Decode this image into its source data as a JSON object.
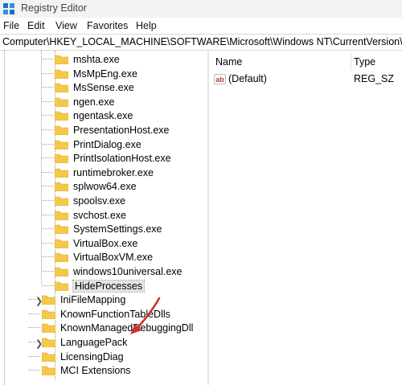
{
  "window": {
    "title": "Registry Editor"
  },
  "menu": [
    "File",
    "Edit",
    "View",
    "Favorites",
    "Help"
  ],
  "address": "Computer\\HKEY_LOCAL_MACHINE\\SOFTWARE\\Microsoft\\Windows NT\\CurrentVersion\\Image",
  "tree": {
    "items": [
      {
        "label": "mshta.exe"
      },
      {
        "label": "MsMpEng.exe"
      },
      {
        "label": "MsSense.exe"
      },
      {
        "label": "ngen.exe"
      },
      {
        "label": "ngentask.exe"
      },
      {
        "label": "PresentationHost.exe"
      },
      {
        "label": "PrintDialog.exe"
      },
      {
        "label": "PrintIsolationHost.exe"
      },
      {
        "label": "runtimebroker.exe"
      },
      {
        "label": "splwow64.exe"
      },
      {
        "label": "spoolsv.exe"
      },
      {
        "label": "svchost.exe"
      },
      {
        "label": "SystemSettings.exe"
      },
      {
        "label": "VirtualBox.exe"
      },
      {
        "label": "VirtualBoxVM.exe"
      },
      {
        "label": "windows10universal.exe"
      },
      {
        "label": "HideProcesses",
        "selected": true
      },
      {
        "label": "IniFileMapping",
        "expandable": true
      },
      {
        "label": "KnownFunctionTableDlls"
      },
      {
        "label": "KnownManagedDebuggingDlls"
      },
      {
        "label": "LanguagePack",
        "expandable": true
      },
      {
        "label": "LicensingDiag"
      },
      {
        "label": "MCI Extensions"
      }
    ]
  },
  "values_list": {
    "columns": {
      "name": "Name",
      "type": "Type"
    },
    "rows": [
      {
        "icon": "ab",
        "name": "(Default)",
        "type": "REG_SZ"
      }
    ]
  },
  "colors": {
    "folder": "#f5c84c",
    "arrow": "#d32f2f",
    "selection": "#e4e4e4"
  }
}
